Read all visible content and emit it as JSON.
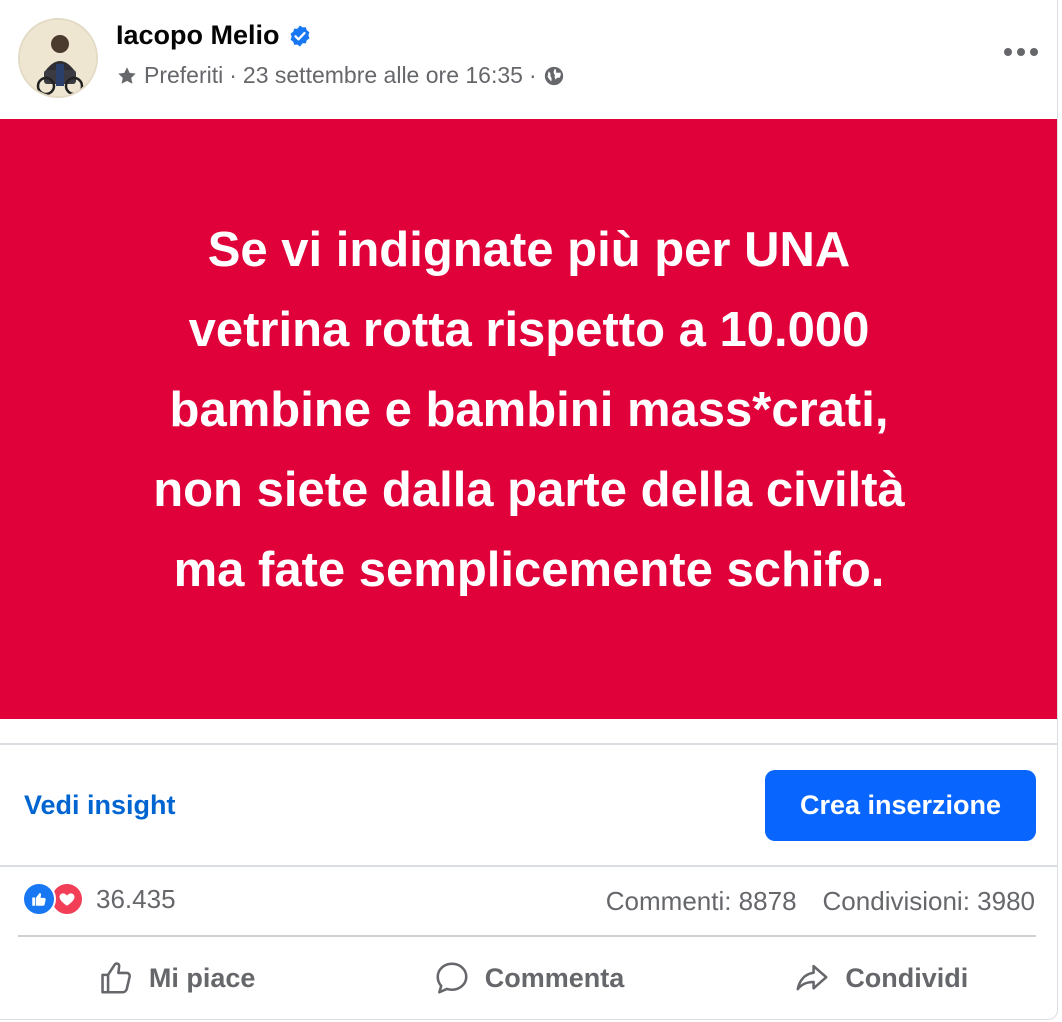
{
  "post": {
    "author": "Iacopo Melio",
    "favorites_label": "Preferiti",
    "separator": "·",
    "timestamp": "23 settembre alle ore 16:35",
    "banner_lines": [
      "Se vi indignate più per UNA",
      "vetrina rotta rispetto a 10.000",
      "bambine e bambini mass*crati,",
      "non siete dalla parte della civiltà",
      "ma fate semplicemente schifo."
    ]
  },
  "insights": {
    "view_label": "Vedi insight",
    "create_ad_label": "Crea inserzione"
  },
  "engagement": {
    "reactions_count": "36.435",
    "comments": "Commenti: 8878",
    "shares": "Condivisioni: 3980"
  },
  "actions": {
    "like": "Mi piace",
    "comment": "Commenta",
    "share": "Condividi"
  },
  "colors": {
    "banner": "#e0003a",
    "accent": "#0866ff",
    "link": "#0064d1",
    "muted": "#65676b"
  },
  "icons": [
    "avatar",
    "verified-badge-icon",
    "star-icon",
    "globe-icon",
    "more-options-icon",
    "like-reaction-icon",
    "love-reaction-icon",
    "thumbs-up-icon",
    "comment-icon",
    "share-icon"
  ]
}
